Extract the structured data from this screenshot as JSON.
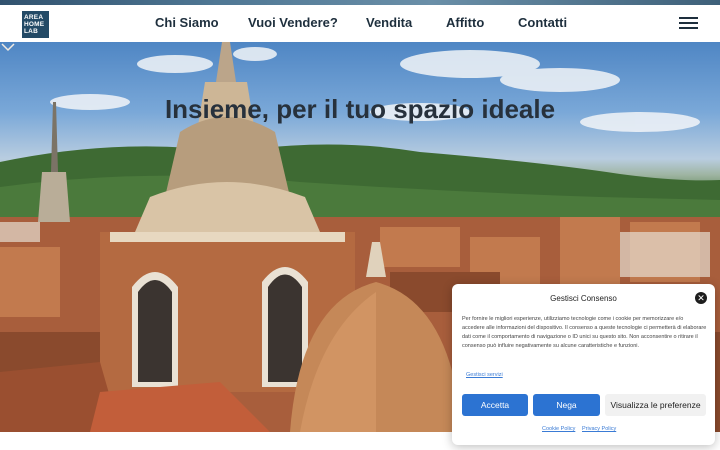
{
  "header": {
    "logo_lines": [
      "AREA",
      "HOME",
      "LAB"
    ],
    "nav": [
      "Chi Siamo",
      "Vuoi Vendere?",
      "Vendita",
      "Affitto",
      "Contatti"
    ]
  },
  "hero": {
    "title": "Insieme, per il tuo spazio ideale"
  },
  "consent": {
    "title": "Gestisci Consenso",
    "text": "Per fornire le migliori esperienze, utilizziamo tecnologie come i cookie per memorizzare e/o accedere alle informazioni del dispositivo. Il consenso a queste tecnologie ci permetterà di elaborare dati come il comportamento di navigazione o ID unici su questo sito. Non acconsentire o ritirare il consenso può influire negativamente su alcune caratteristiche e funzioni.",
    "manage_services": "Gestisci servizi",
    "accept": "Accetta",
    "deny": "Nega",
    "preferences": "Visualizza le preferenze",
    "cookie_policy": "Cookie Policy",
    "privacy_policy": "Privacy Policy",
    "close_glyph": "✕"
  },
  "colors": {
    "primary_button": "#2c73d2",
    "text_dark": "#1e2f3d",
    "logo_bg": "#234a66"
  }
}
